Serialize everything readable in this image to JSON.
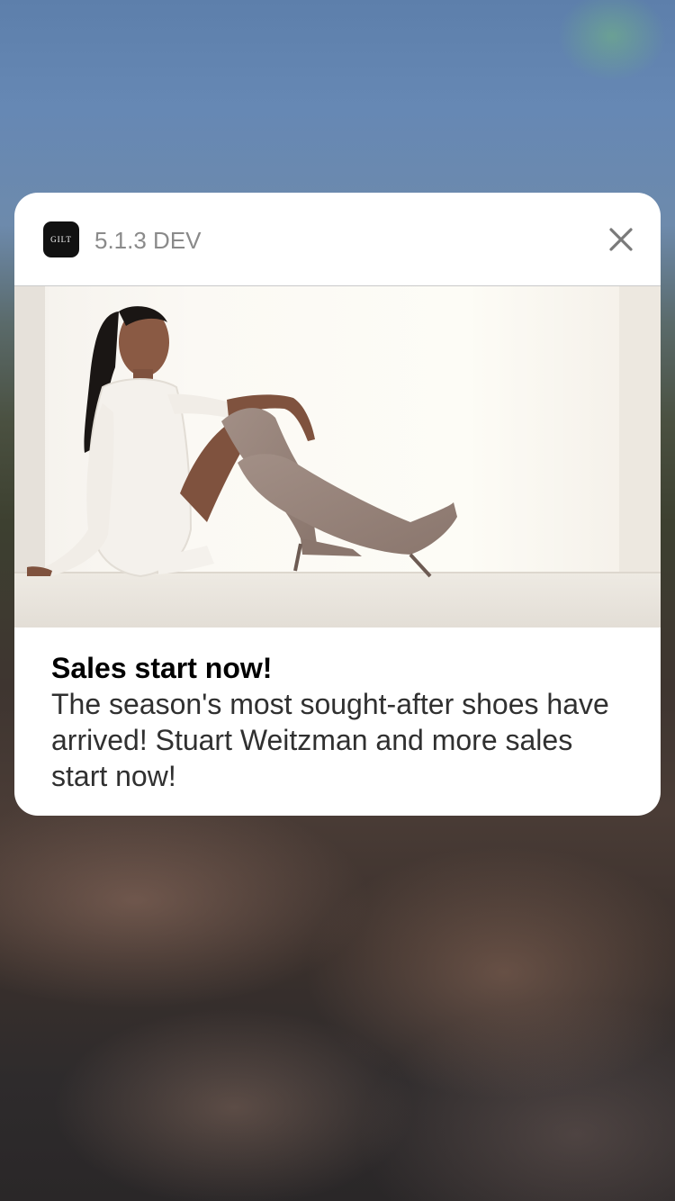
{
  "notification": {
    "app_icon_text": "GILT",
    "app_name": "5.1.3 DEV",
    "close_icon": "close-icon",
    "image": "promotional-photo-model-in-over-the-knee-boots",
    "title": "Sales start now!",
    "message": "The season's most sought-after shoes have arrived! Stuart Weitzman and more sales start now!"
  },
  "colors": {
    "card_background": "#ffffff",
    "app_icon_background": "#111111",
    "app_name_text": "#8a8a8a",
    "title_text": "#000000",
    "message_text": "#303030"
  }
}
